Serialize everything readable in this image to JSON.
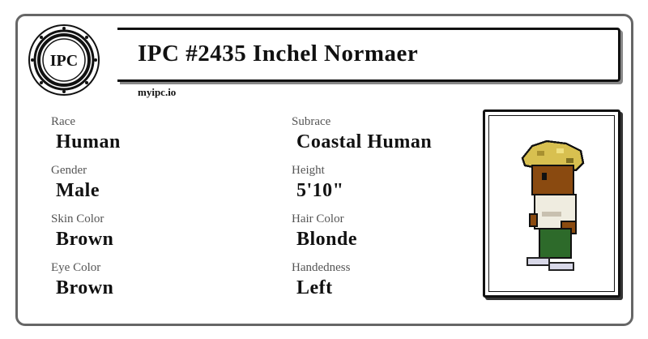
{
  "header": {
    "title": "IPC #2435 Inchel Normaer",
    "site": "myipc.io",
    "logo_text": "IPC"
  },
  "fields": [
    {
      "label": "Race",
      "value": "Human"
    },
    {
      "label": "Subrace",
      "value": "Coastal Human"
    },
    {
      "label": "Gender",
      "value": "Male"
    },
    {
      "label": "Height",
      "value": "5'10\""
    },
    {
      "label": "Skin Color",
      "value": "Brown"
    },
    {
      "label": "Hair Color",
      "value": "Blonde"
    },
    {
      "label": "Eye Color",
      "value": "Brown"
    },
    {
      "label": "Handedness",
      "value": "Left"
    }
  ],
  "colors": {
    "border": "#666666",
    "hair": "#d8c050",
    "skin": "#8a4a10",
    "shirt": "#efece0",
    "pants": "#2d6a2a"
  }
}
